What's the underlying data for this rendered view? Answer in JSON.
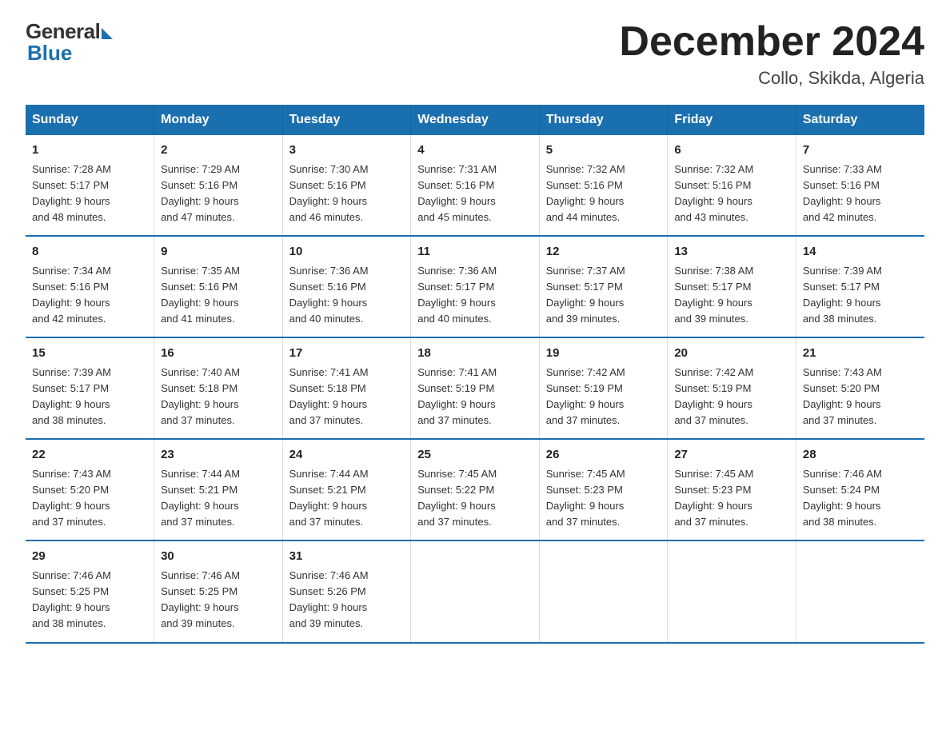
{
  "logo": {
    "general": "General",
    "blue": "Blue"
  },
  "title": "December 2024",
  "location": "Collo, Skikda, Algeria",
  "days_of_week": [
    "Sunday",
    "Monday",
    "Tuesday",
    "Wednesday",
    "Thursday",
    "Friday",
    "Saturday"
  ],
  "weeks": [
    [
      {
        "day": "1",
        "sunrise": "7:28 AM",
        "sunset": "5:17 PM",
        "daylight": "9 hours and 48 minutes."
      },
      {
        "day": "2",
        "sunrise": "7:29 AM",
        "sunset": "5:16 PM",
        "daylight": "9 hours and 47 minutes."
      },
      {
        "day": "3",
        "sunrise": "7:30 AM",
        "sunset": "5:16 PM",
        "daylight": "9 hours and 46 minutes."
      },
      {
        "day": "4",
        "sunrise": "7:31 AM",
        "sunset": "5:16 PM",
        "daylight": "9 hours and 45 minutes."
      },
      {
        "day": "5",
        "sunrise": "7:32 AM",
        "sunset": "5:16 PM",
        "daylight": "9 hours and 44 minutes."
      },
      {
        "day": "6",
        "sunrise": "7:32 AM",
        "sunset": "5:16 PM",
        "daylight": "9 hours and 43 minutes."
      },
      {
        "day": "7",
        "sunrise": "7:33 AM",
        "sunset": "5:16 PM",
        "daylight": "9 hours and 42 minutes."
      }
    ],
    [
      {
        "day": "8",
        "sunrise": "7:34 AM",
        "sunset": "5:16 PM",
        "daylight": "9 hours and 42 minutes."
      },
      {
        "day": "9",
        "sunrise": "7:35 AM",
        "sunset": "5:16 PM",
        "daylight": "9 hours and 41 minutes."
      },
      {
        "day": "10",
        "sunrise": "7:36 AM",
        "sunset": "5:16 PM",
        "daylight": "9 hours and 40 minutes."
      },
      {
        "day": "11",
        "sunrise": "7:36 AM",
        "sunset": "5:17 PM",
        "daylight": "9 hours and 40 minutes."
      },
      {
        "day": "12",
        "sunrise": "7:37 AM",
        "sunset": "5:17 PM",
        "daylight": "9 hours and 39 minutes."
      },
      {
        "day": "13",
        "sunrise": "7:38 AM",
        "sunset": "5:17 PM",
        "daylight": "9 hours and 39 minutes."
      },
      {
        "day": "14",
        "sunrise": "7:39 AM",
        "sunset": "5:17 PM",
        "daylight": "9 hours and 38 minutes."
      }
    ],
    [
      {
        "day": "15",
        "sunrise": "7:39 AM",
        "sunset": "5:17 PM",
        "daylight": "9 hours and 38 minutes."
      },
      {
        "day": "16",
        "sunrise": "7:40 AM",
        "sunset": "5:18 PM",
        "daylight": "9 hours and 37 minutes."
      },
      {
        "day": "17",
        "sunrise": "7:41 AM",
        "sunset": "5:18 PM",
        "daylight": "9 hours and 37 minutes."
      },
      {
        "day": "18",
        "sunrise": "7:41 AM",
        "sunset": "5:19 PM",
        "daylight": "9 hours and 37 minutes."
      },
      {
        "day": "19",
        "sunrise": "7:42 AM",
        "sunset": "5:19 PM",
        "daylight": "9 hours and 37 minutes."
      },
      {
        "day": "20",
        "sunrise": "7:42 AM",
        "sunset": "5:19 PM",
        "daylight": "9 hours and 37 minutes."
      },
      {
        "day": "21",
        "sunrise": "7:43 AM",
        "sunset": "5:20 PM",
        "daylight": "9 hours and 37 minutes."
      }
    ],
    [
      {
        "day": "22",
        "sunrise": "7:43 AM",
        "sunset": "5:20 PM",
        "daylight": "9 hours and 37 minutes."
      },
      {
        "day": "23",
        "sunrise": "7:44 AM",
        "sunset": "5:21 PM",
        "daylight": "9 hours and 37 minutes."
      },
      {
        "day": "24",
        "sunrise": "7:44 AM",
        "sunset": "5:21 PM",
        "daylight": "9 hours and 37 minutes."
      },
      {
        "day": "25",
        "sunrise": "7:45 AM",
        "sunset": "5:22 PM",
        "daylight": "9 hours and 37 minutes."
      },
      {
        "day": "26",
        "sunrise": "7:45 AM",
        "sunset": "5:23 PM",
        "daylight": "9 hours and 37 minutes."
      },
      {
        "day": "27",
        "sunrise": "7:45 AM",
        "sunset": "5:23 PM",
        "daylight": "9 hours and 37 minutes."
      },
      {
        "day": "28",
        "sunrise": "7:46 AM",
        "sunset": "5:24 PM",
        "daylight": "9 hours and 38 minutes."
      }
    ],
    [
      {
        "day": "29",
        "sunrise": "7:46 AM",
        "sunset": "5:25 PM",
        "daylight": "9 hours and 38 minutes."
      },
      {
        "day": "30",
        "sunrise": "7:46 AM",
        "sunset": "5:25 PM",
        "daylight": "9 hours and 39 minutes."
      },
      {
        "day": "31",
        "sunrise": "7:46 AM",
        "sunset": "5:26 PM",
        "daylight": "9 hours and 39 minutes."
      },
      null,
      null,
      null,
      null
    ]
  ]
}
